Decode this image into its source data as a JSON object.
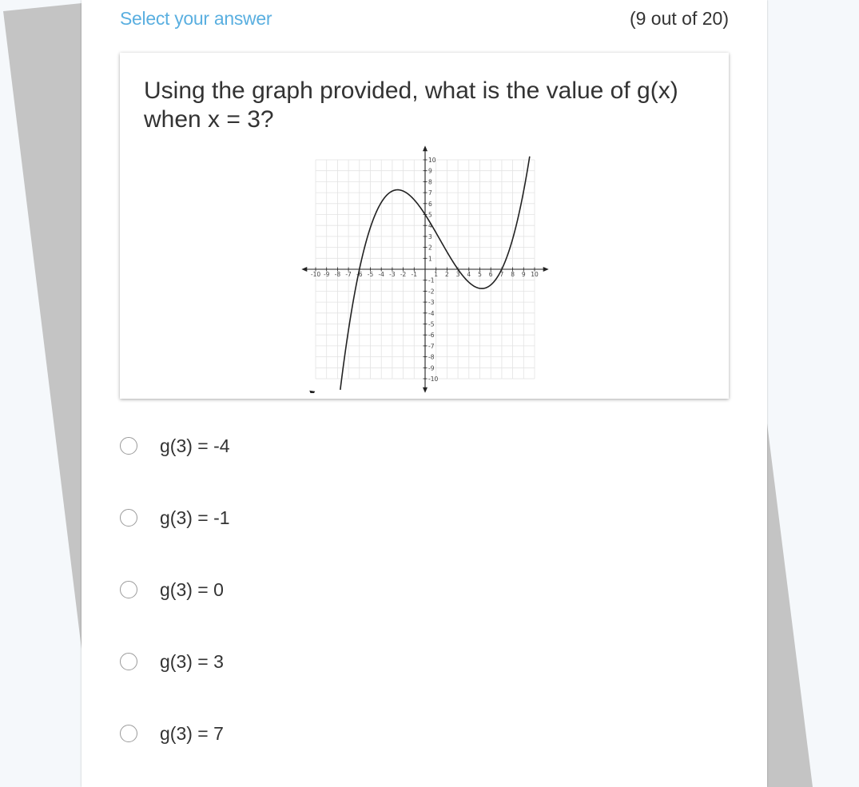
{
  "header": {
    "title": "Select your answer",
    "progress": "(9 out of 20)"
  },
  "question": {
    "text": "Using the graph provided, what is the value of g(x) when x = 3?"
  },
  "graph": {
    "x_ticks_negative": [
      "-10",
      "-9",
      "-8",
      "-7",
      "-6",
      "-5",
      "-4",
      "-3",
      "-2",
      "-1"
    ],
    "x_ticks_positive": [
      "1",
      "2",
      "3",
      "4",
      "5",
      "6",
      "7",
      "8",
      "9",
      "10"
    ],
    "y_ticks_positive": [
      "1",
      "2",
      "3",
      "4",
      "5",
      "6",
      "7",
      "8",
      "9",
      "10"
    ],
    "y_ticks_negative": [
      "-1",
      "-2",
      "-3",
      "-4",
      "-5",
      "-6",
      "-7",
      "-8",
      "-9",
      "-10"
    ]
  },
  "options": [
    {
      "label": "g(3) = -4",
      "selected": false
    },
    {
      "label": "g(3) = -1",
      "selected": false
    },
    {
      "label": "g(3) = 0",
      "selected": false
    },
    {
      "label": "g(3) = 3",
      "selected": false
    },
    {
      "label": "g(3) = 7",
      "selected": false
    }
  ],
  "colors": {
    "accent": "#5aafe0",
    "text": "#333333",
    "background": "#f5f8fb",
    "shadow_sheet": "#c4c4c4"
  }
}
